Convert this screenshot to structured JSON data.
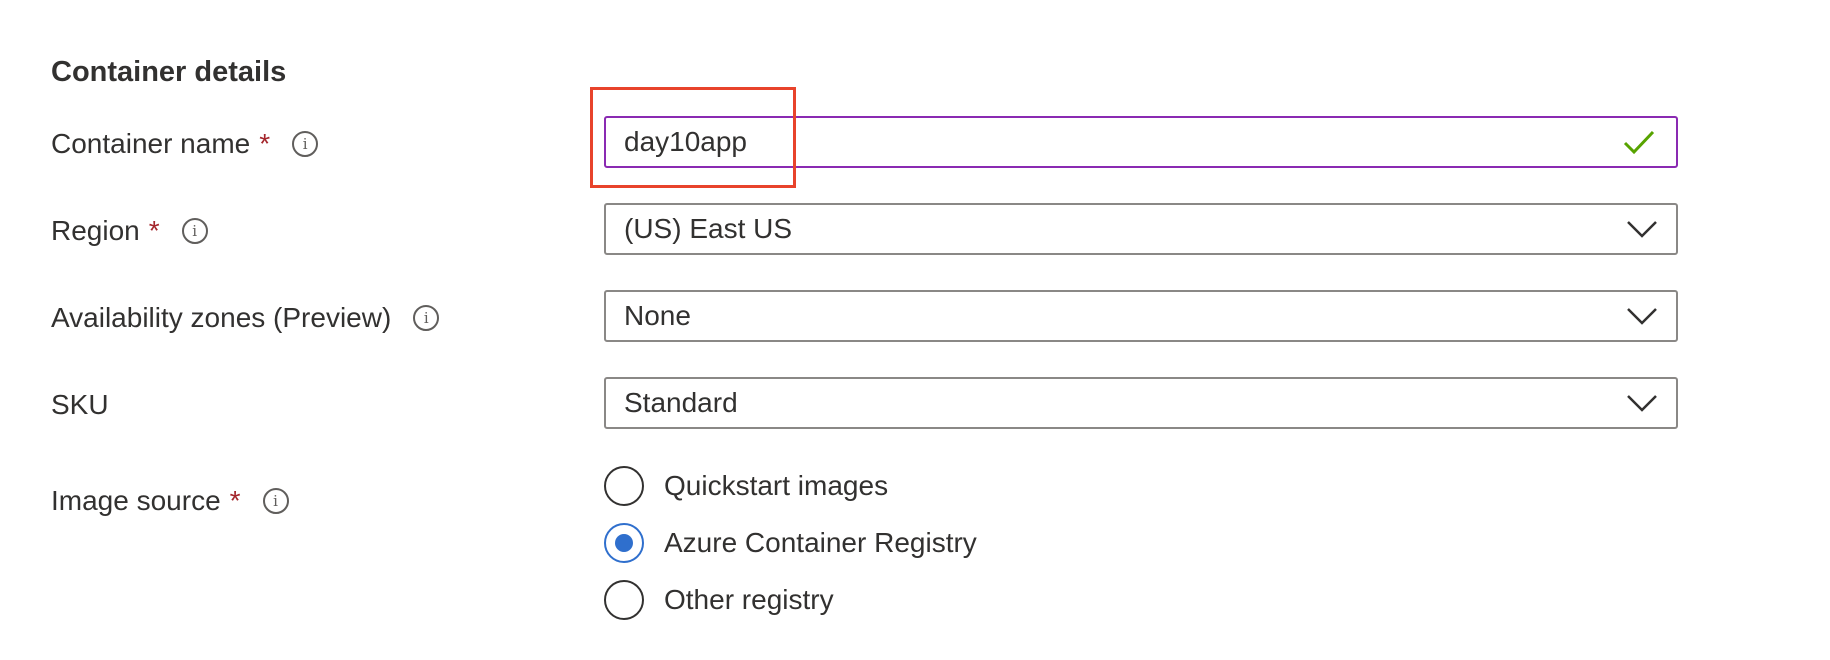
{
  "section": {
    "title": "Container details"
  },
  "container_name": {
    "label": "Container name",
    "required_mark": "*",
    "info_icon": "info-icon",
    "value": "day10app",
    "validation_icon": "checkmark-icon",
    "accent_color": "#8a2ab2",
    "check_color": "#57a300"
  },
  "region": {
    "label": "Region",
    "required_mark": "*",
    "info_icon": "info-icon",
    "value": "(US) East US"
  },
  "availability_zones": {
    "label": "Availability zones (Preview)",
    "info_icon": "info-icon",
    "value": "None"
  },
  "sku": {
    "label": "SKU",
    "value": "Standard"
  },
  "image_source": {
    "label": "Image source",
    "required_mark": "*",
    "info_icon": "info-icon",
    "options": [
      {
        "label": "Quickstart images",
        "selected": false
      },
      {
        "label": "Azure Container Registry",
        "selected": true
      },
      {
        "label": "Other registry",
        "selected": false
      }
    ],
    "accent_color": "#2f6fcd"
  },
  "annotation": {
    "highlight_color": "#e8432b"
  }
}
